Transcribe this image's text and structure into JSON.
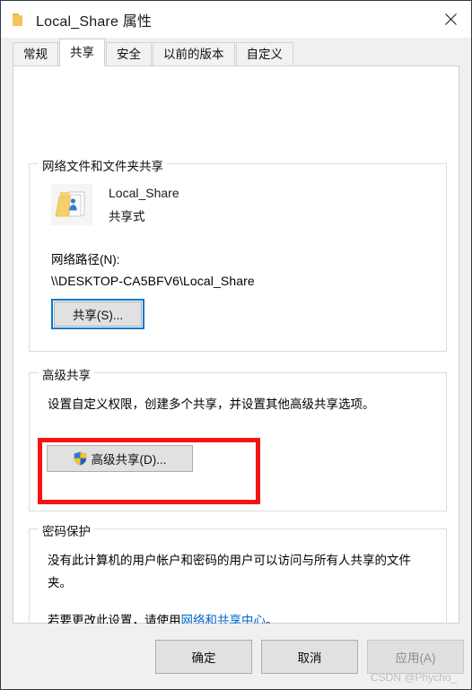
{
  "window": {
    "title": "Local_Share 属性",
    "folder_icon": "folder-icon",
    "close_icon": "close-icon"
  },
  "tabs": [
    {
      "label": "常规",
      "active": false
    },
    {
      "label": "共享",
      "active": true
    },
    {
      "label": "安全",
      "active": false
    },
    {
      "label": "以前的版本",
      "active": false
    },
    {
      "label": "自定义",
      "active": false
    }
  ],
  "network_share_group": {
    "title": "网络文件和文件夹共享",
    "folder_icon": "shared-folder-icon",
    "share_name": "Local_Share",
    "share_state": "共享式",
    "network_path_label": "网络路径(N):",
    "network_path_value": "\\\\DESKTOP-CA5BFV6\\Local_Share",
    "share_button_label": "共享(S)...",
    "share_button_focused": true
  },
  "advanced_share_group": {
    "title": "高级共享",
    "description": "设置自定义权限，创建多个共享，并设置其他高级共享选项。",
    "button_label": "高级共享(D)...",
    "button_icon": "uac-shield-icon",
    "highlighted": true,
    "highlight_color": "#f51414"
  },
  "password_protection_group": {
    "title": "密码保护",
    "description": "没有此计算机的用户帐户和密码的用户可以访问与所有人共享的文件夹。",
    "hint_prefix": "若要更改此设置，请使用",
    "hint_link": "网络和共享中心",
    "hint_suffix": "。"
  },
  "footer": {
    "ok_label": "确定",
    "cancel_label": "取消",
    "apply_label": "应用(A)",
    "apply_disabled": true
  },
  "watermark": "CSDN @Phycho_",
  "colors": {
    "accent": "#0078d7",
    "link": "#0066cc",
    "annotation": "#f51414",
    "dialog_bg": "#f0f0f0",
    "panel_bg": "#ffffff"
  }
}
